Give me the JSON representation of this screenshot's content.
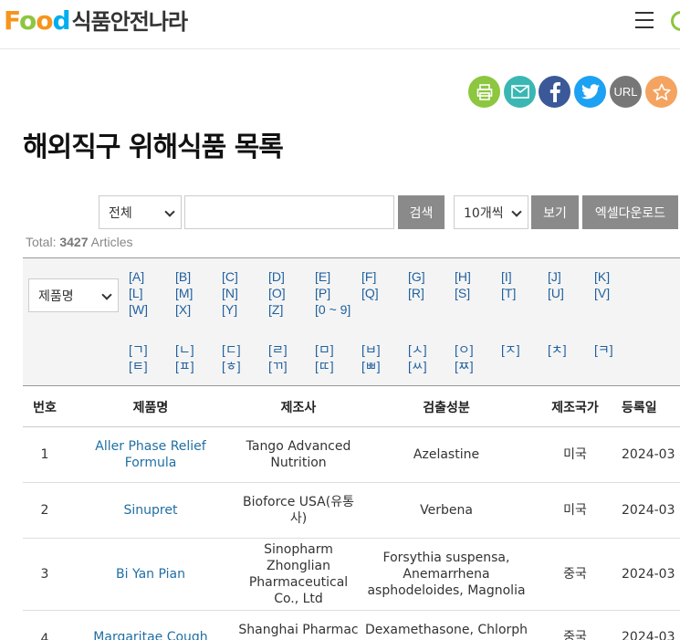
{
  "header": {
    "logo_food": [
      "F",
      "o",
      "o",
      "d"
    ],
    "logo_korean": "식품안전나라"
  },
  "share": {
    "url_label": "URL"
  },
  "page_title": "해외직구 위해식품 목록",
  "search": {
    "category_select": "전체",
    "keyword_value": "",
    "search_button": "검색",
    "count_select": "10개씩",
    "view_button": "보기",
    "excel_button": "엑셀다운로드"
  },
  "total": {
    "prefix": "Total:",
    "count": "3427",
    "suffix": "Articles"
  },
  "filter": {
    "field_select": "제품명",
    "alpha_keys": [
      "[A]",
      "[B]",
      "[C]",
      "[D]",
      "[E]",
      "[F]",
      "[G]",
      "[H]",
      "[I]",
      "[J]",
      "[K]",
      "[L]",
      "[M]",
      "[N]",
      "[O]",
      "[P]",
      "[Q]",
      "[R]",
      "[S]",
      "[T]",
      "[U]",
      "[V]",
      "[W]",
      "[X]",
      "[Y]",
      "[Z]",
      "[0 ~ 9]"
    ],
    "hangul_keys": [
      "[ㄱ]",
      "[ㄴ]",
      "[ㄷ]",
      "[ㄹ]",
      "[ㅁ]",
      "[ㅂ]",
      "[ㅅ]",
      "[ㅇ]",
      "[ㅈ]",
      "[ㅊ]",
      "[ㅋ]",
      "[ㅌ]",
      "[ㅍ]",
      "[ㅎ]",
      "[ㄲ]",
      "[ㄸ]",
      "[ㅃ]",
      "[ㅆ]",
      "[ㅉ]"
    ]
  },
  "table": {
    "headers": [
      "번호",
      "제품명",
      "제조사",
      "검출성분",
      "제조국가",
      "등록일"
    ],
    "rows": [
      {
        "no": "1",
        "name": "Aller Phase Relief Formula",
        "maker": "Tango Advanced Nutrition",
        "ingredient": "Azelastine",
        "country": "미국",
        "date": "2024-03"
      },
      {
        "no": "2",
        "name": "Sinupret",
        "maker": "Bioforce USA(유통사)",
        "ingredient": "Verbena",
        "country": "미국",
        "date": "2024-03"
      },
      {
        "no": "3",
        "name": "Bi Yan Pian",
        "maker": "Sinopharm Zhonglian Pharmaceutical Co., Ltd",
        "ingredient": "Forsythia suspensa, Anemarrhena asphodeloides, Magnolia",
        "country": "중국",
        "date": "2024-03"
      },
      {
        "no": "4",
        "name": "Margaritae Cough",
        "maker": "Shanghai Pharmac",
        "ingredient": "Dexamethasone, Chlorph",
        "country": "중국",
        "date": "2024-03"
      }
    ]
  },
  "colors": {
    "print": "#8dc63f",
    "mail": "#3ab7b3",
    "facebook": "#3b5998",
    "twitter": "#1da1f2",
    "url": "#777777",
    "favorite": "#f4a460",
    "link": "#1f6fa3",
    "button": "#8a8a8a"
  },
  "icons": [
    "menu-icon",
    "print-icon",
    "mail-icon",
    "facebook-icon",
    "twitter-icon",
    "star-icon",
    "chevron-down-icon"
  ]
}
